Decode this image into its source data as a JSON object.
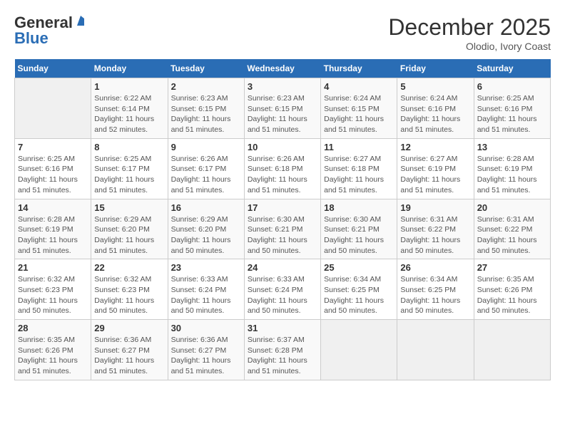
{
  "header": {
    "logo_general": "General",
    "logo_blue": "Blue",
    "month_title": "December 2025",
    "location": "Olodio, Ivory Coast"
  },
  "weekdays": [
    "Sunday",
    "Monday",
    "Tuesday",
    "Wednesday",
    "Thursday",
    "Friday",
    "Saturday"
  ],
  "weeks": [
    [
      {
        "day": "",
        "sunrise": "",
        "sunset": "",
        "daylight": ""
      },
      {
        "day": "1",
        "sunrise": "Sunrise: 6:22 AM",
        "sunset": "Sunset: 6:14 PM",
        "daylight": "Daylight: 11 hours and 52 minutes."
      },
      {
        "day": "2",
        "sunrise": "Sunrise: 6:23 AM",
        "sunset": "Sunset: 6:15 PM",
        "daylight": "Daylight: 11 hours and 51 minutes."
      },
      {
        "day": "3",
        "sunrise": "Sunrise: 6:23 AM",
        "sunset": "Sunset: 6:15 PM",
        "daylight": "Daylight: 11 hours and 51 minutes."
      },
      {
        "day": "4",
        "sunrise": "Sunrise: 6:24 AM",
        "sunset": "Sunset: 6:15 PM",
        "daylight": "Daylight: 11 hours and 51 minutes."
      },
      {
        "day": "5",
        "sunrise": "Sunrise: 6:24 AM",
        "sunset": "Sunset: 6:16 PM",
        "daylight": "Daylight: 11 hours and 51 minutes."
      },
      {
        "day": "6",
        "sunrise": "Sunrise: 6:25 AM",
        "sunset": "Sunset: 6:16 PM",
        "daylight": "Daylight: 11 hours and 51 minutes."
      }
    ],
    [
      {
        "day": "7",
        "sunrise": "Sunrise: 6:25 AM",
        "sunset": "Sunset: 6:16 PM",
        "daylight": "Daylight: 11 hours and 51 minutes."
      },
      {
        "day": "8",
        "sunrise": "Sunrise: 6:25 AM",
        "sunset": "Sunset: 6:17 PM",
        "daylight": "Daylight: 11 hours and 51 minutes."
      },
      {
        "day": "9",
        "sunrise": "Sunrise: 6:26 AM",
        "sunset": "Sunset: 6:17 PM",
        "daylight": "Daylight: 11 hours and 51 minutes."
      },
      {
        "day": "10",
        "sunrise": "Sunrise: 6:26 AM",
        "sunset": "Sunset: 6:18 PM",
        "daylight": "Daylight: 11 hours and 51 minutes."
      },
      {
        "day": "11",
        "sunrise": "Sunrise: 6:27 AM",
        "sunset": "Sunset: 6:18 PM",
        "daylight": "Daylight: 11 hours and 51 minutes."
      },
      {
        "day": "12",
        "sunrise": "Sunrise: 6:27 AM",
        "sunset": "Sunset: 6:19 PM",
        "daylight": "Daylight: 11 hours and 51 minutes."
      },
      {
        "day": "13",
        "sunrise": "Sunrise: 6:28 AM",
        "sunset": "Sunset: 6:19 PM",
        "daylight": "Daylight: 11 hours and 51 minutes."
      }
    ],
    [
      {
        "day": "14",
        "sunrise": "Sunrise: 6:28 AM",
        "sunset": "Sunset: 6:19 PM",
        "daylight": "Daylight: 11 hours and 51 minutes."
      },
      {
        "day": "15",
        "sunrise": "Sunrise: 6:29 AM",
        "sunset": "Sunset: 6:20 PM",
        "daylight": "Daylight: 11 hours and 51 minutes."
      },
      {
        "day": "16",
        "sunrise": "Sunrise: 6:29 AM",
        "sunset": "Sunset: 6:20 PM",
        "daylight": "Daylight: 11 hours and 50 minutes."
      },
      {
        "day": "17",
        "sunrise": "Sunrise: 6:30 AM",
        "sunset": "Sunset: 6:21 PM",
        "daylight": "Daylight: 11 hours and 50 minutes."
      },
      {
        "day": "18",
        "sunrise": "Sunrise: 6:30 AM",
        "sunset": "Sunset: 6:21 PM",
        "daylight": "Daylight: 11 hours and 50 minutes."
      },
      {
        "day": "19",
        "sunrise": "Sunrise: 6:31 AM",
        "sunset": "Sunset: 6:22 PM",
        "daylight": "Daylight: 11 hours and 50 minutes."
      },
      {
        "day": "20",
        "sunrise": "Sunrise: 6:31 AM",
        "sunset": "Sunset: 6:22 PM",
        "daylight": "Daylight: 11 hours and 50 minutes."
      }
    ],
    [
      {
        "day": "21",
        "sunrise": "Sunrise: 6:32 AM",
        "sunset": "Sunset: 6:23 PM",
        "daylight": "Daylight: 11 hours and 50 minutes."
      },
      {
        "day": "22",
        "sunrise": "Sunrise: 6:32 AM",
        "sunset": "Sunset: 6:23 PM",
        "daylight": "Daylight: 11 hours and 50 minutes."
      },
      {
        "day": "23",
        "sunrise": "Sunrise: 6:33 AM",
        "sunset": "Sunset: 6:24 PM",
        "daylight": "Daylight: 11 hours and 50 minutes."
      },
      {
        "day": "24",
        "sunrise": "Sunrise: 6:33 AM",
        "sunset": "Sunset: 6:24 PM",
        "daylight": "Daylight: 11 hours and 50 minutes."
      },
      {
        "day": "25",
        "sunrise": "Sunrise: 6:34 AM",
        "sunset": "Sunset: 6:25 PM",
        "daylight": "Daylight: 11 hours and 50 minutes."
      },
      {
        "day": "26",
        "sunrise": "Sunrise: 6:34 AM",
        "sunset": "Sunset: 6:25 PM",
        "daylight": "Daylight: 11 hours and 50 minutes."
      },
      {
        "day": "27",
        "sunrise": "Sunrise: 6:35 AM",
        "sunset": "Sunset: 6:26 PM",
        "daylight": "Daylight: 11 hours and 50 minutes."
      }
    ],
    [
      {
        "day": "28",
        "sunrise": "Sunrise: 6:35 AM",
        "sunset": "Sunset: 6:26 PM",
        "daylight": "Daylight: 11 hours and 51 minutes."
      },
      {
        "day": "29",
        "sunrise": "Sunrise: 6:36 AM",
        "sunset": "Sunset: 6:27 PM",
        "daylight": "Daylight: 11 hours and 51 minutes."
      },
      {
        "day": "30",
        "sunrise": "Sunrise: 6:36 AM",
        "sunset": "Sunset: 6:27 PM",
        "daylight": "Daylight: 11 hours and 51 minutes."
      },
      {
        "day": "31",
        "sunrise": "Sunrise: 6:37 AM",
        "sunset": "Sunset: 6:28 PM",
        "daylight": "Daylight: 11 hours and 51 minutes."
      },
      {
        "day": "",
        "sunrise": "",
        "sunset": "",
        "daylight": ""
      },
      {
        "day": "",
        "sunrise": "",
        "sunset": "",
        "daylight": ""
      },
      {
        "day": "",
        "sunrise": "",
        "sunset": "",
        "daylight": ""
      }
    ]
  ]
}
